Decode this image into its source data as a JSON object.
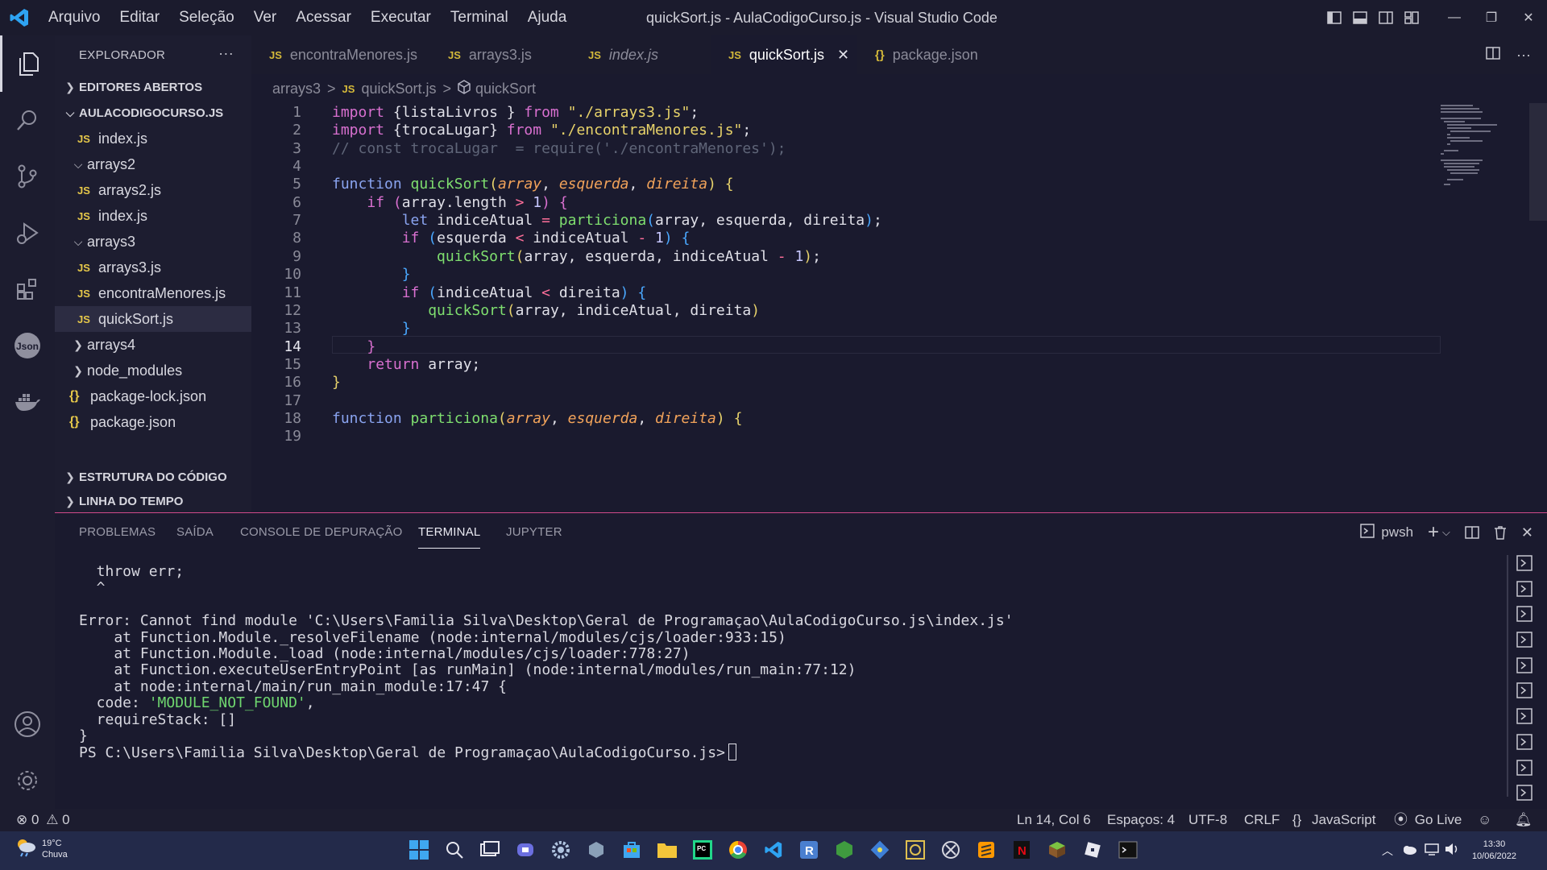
{
  "window": {
    "title": "quickSort.js - AulaCodigoCurso.js - Visual Studio Code"
  },
  "menu": [
    "Arquivo",
    "Editar",
    "Seleção",
    "Ver",
    "Acessar",
    "Executar",
    "Terminal",
    "Ajuda"
  ],
  "sidebar": {
    "title": "EXPLORADOR",
    "open_editors": "EDITORES ABERTOS",
    "project": "AULACODIGOCURSO.JS",
    "tree": [
      {
        "label": "index.js",
        "type": "js"
      },
      {
        "label": "arrays2",
        "type": "folder-open"
      },
      {
        "label": "arrays2.js",
        "type": "js"
      },
      {
        "label": "index.js",
        "type": "js"
      },
      {
        "label": "arrays3",
        "type": "folder-open"
      },
      {
        "label": "arrays3.js",
        "type": "js"
      },
      {
        "label": "encontraMenores.js",
        "type": "js"
      },
      {
        "label": "quickSort.js",
        "type": "js"
      },
      {
        "label": "arrays4",
        "type": "folder"
      },
      {
        "label": "node_modules",
        "type": "folder"
      },
      {
        "label": "package-lock.json",
        "type": "json"
      },
      {
        "label": "package.json",
        "type": "json"
      }
    ],
    "outline": "ESTRUTURA DO CÓDIGO",
    "timeline": "LINHA DO TEMPO",
    "js_badge": "JS",
    "json_badge": "{}"
  },
  "tabs": [
    {
      "label": "encontraMenores.js",
      "icon": "JS"
    },
    {
      "label": "arrays3.js",
      "icon": "JS"
    },
    {
      "label": "index.js",
      "icon": "JS"
    },
    {
      "label": "quickSort.js",
      "icon": "JS",
      "close": "✕"
    },
    {
      "label": "package.json",
      "icon": "{}"
    }
  ],
  "breadcrumb": {
    "folder": "arrays3",
    "file": "quickSort.js",
    "symbol": "quickSort",
    "sep": ">",
    "js": "JS"
  },
  "editor": {
    "line_numbers": [
      "1",
      "2",
      "3",
      "4",
      "5",
      "6",
      "7",
      "8",
      "9",
      "10",
      "11",
      "12",
      "13",
      "14",
      "15",
      "16",
      "17",
      "18",
      "19"
    ],
    "tokens": {
      "import": "import",
      "from": "from",
      "function": "function",
      "if": "if",
      "let": "let",
      "return": "return",
      "listaLivros": " {listaLivros } ",
      "trocaLugarImp": " {trocaLugar} ",
      "arrays3": "\"./arrays3.js\"",
      "encontra": "\"./encontraMenores.js\"",
      "comment": "// const trocaLugar  = require('./encontraMenores');",
      "quickSort": "quickSort",
      "particiona": "particiona",
      "array": "array",
      "esquerda": "esquerda",
      "direita": "direita",
      "indiceAtual": "indiceAtual",
      "length": "array.length",
      "one": "1"
    }
  },
  "panel": {
    "tabs": [
      "PROBLEMAS",
      "SAÍDA",
      "CONSOLE DE DEPURAÇÃO",
      "TERMINAL",
      "JUPYTER"
    ],
    "shell": "pwsh",
    "terminal_lines": [
      "  throw err;",
      "  ^",
      "",
      "Error: Cannot find module 'C:\\Users\\Familia Silva\\Desktop\\Geral de Programaçao\\AulaCodigoCurso.js\\index.js'",
      "    at Function.Module._resolveFilename (node:internal/modules/cjs/loader:933:15)",
      "    at Function.Module._load (node:internal/modules/cjs/loader:778:27)",
      "    at Function.executeUserEntryPoint [as runMain] (node:internal/modules/run_main:77:12)",
      "    at node:internal/main/run_main_module:17:47 {"
    ],
    "code_label": "  code: ",
    "code_value": "'MODULE_NOT_FOUND'",
    "code_comma": ",",
    "require_stack": "  requireStack: []",
    "close_brace": "}",
    "prompt": "PS C:\\Users\\Familia Silva\\Desktop\\Geral de Programaçao\\AulaCodigoCurso.js>"
  },
  "status": {
    "errors": "0",
    "warnings": "0",
    "position": "Ln 14, Col 6",
    "spaces": "Espaços: 4",
    "encoding": "UTF-8",
    "eol": "CRLF",
    "language": "JavaScript",
    "golive": "Go Live"
  },
  "taskbar": {
    "temp": "19°C",
    "weather": "Chuva",
    "time": "13:30",
    "date": "10/06/2022"
  },
  "colors": {
    "accent_pink": "#d04a8a",
    "keyword": "#d970d0",
    "function": "#7fdf6f",
    "string": "#e8d36a",
    "param": "#f2a35a"
  }
}
